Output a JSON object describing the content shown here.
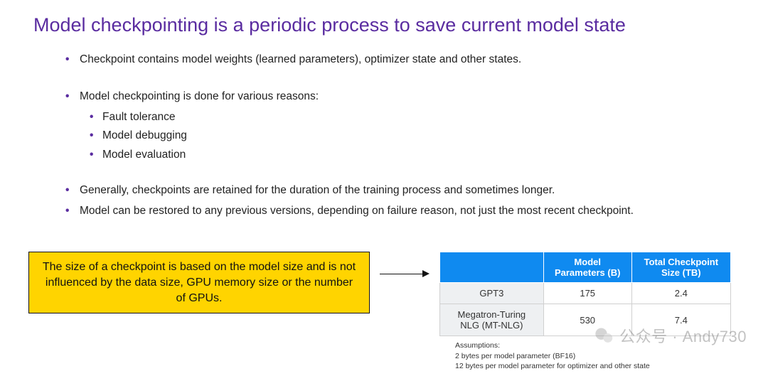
{
  "title": "Model checkpointing is a periodic process to save current model state",
  "bullets": {
    "b0": "Checkpoint contains model weights (learned parameters), optimizer state and other states.",
    "b1": "Model checkpointing is done for various reasons:",
    "b1_sub": {
      "s0": "Fault tolerance",
      "s1": "Model debugging",
      "s2": "Model evaluation"
    },
    "b2": "Generally, checkpoints are retained for the duration of the training process and sometimes longer.",
    "b3": "Model can be restored to any previous versions, depending on failure reason, not just the most recent checkpoint."
  },
  "callout": "The size of a checkpoint is based on the model size and is not influenced by the data size, GPU memory size or the number of GPUs.",
  "table": {
    "h0": "",
    "h1": "Model Parameters (B)",
    "h2": "Total Checkpoint Size (TB)",
    "rows": {
      "r0": {
        "c0": "GPT3",
        "c1": "175",
        "c2": "2.4"
      },
      "r1": {
        "c0": "Megatron-Turing NLG (MT-NLG)",
        "c1": "530",
        "c2": "7.4"
      }
    }
  },
  "assumptions": {
    "a0": "Assumptions:",
    "a1": "2 bytes per model parameter (BF16)",
    "a2": "12 bytes per model parameter for optimizer and other state"
  },
  "watermark": "公众号 · Andy730"
}
